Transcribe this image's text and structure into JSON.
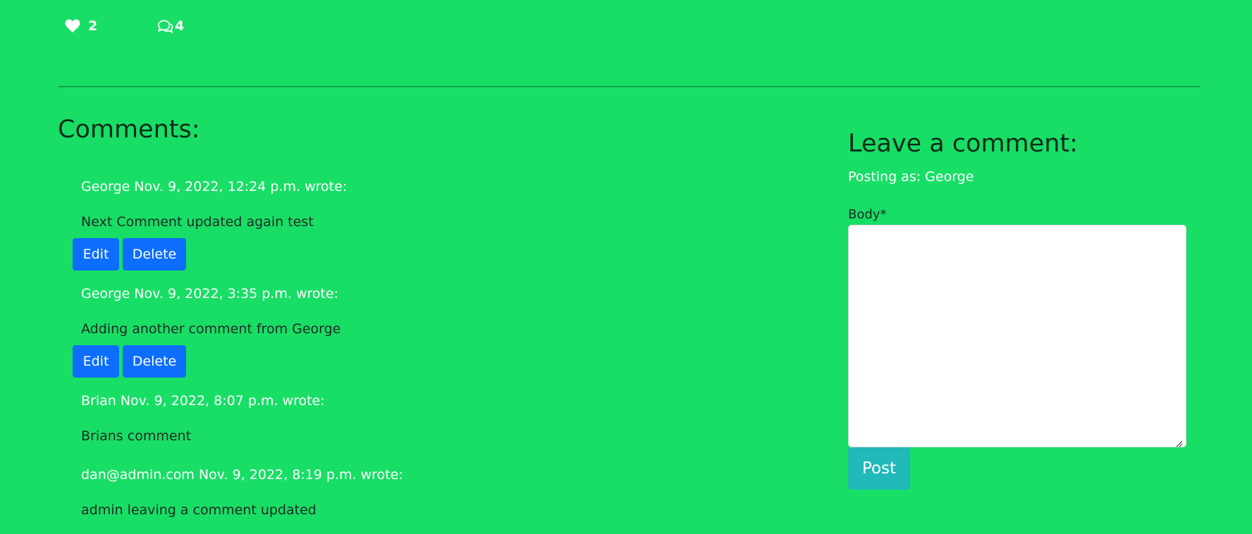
{
  "post_stats": {
    "likes": "2",
    "comments": "4",
    "like_icon": "heart-icon",
    "comment_icon": "chat-bubbles-icon"
  },
  "comments_section": {
    "title": "Comments:",
    "items": [
      {
        "meta": "George Nov. 9, 2022, 12:24 p.m. wrote:",
        "body": "Next Comment updated again test",
        "edit_label": "Edit",
        "delete_label": "Delete"
      },
      {
        "meta": "George Nov. 9, 2022, 3:35 p.m. wrote:",
        "body": "Adding another comment from George",
        "edit_label": "Edit",
        "delete_label": "Delete"
      },
      {
        "meta": "Brian Nov. 9, 2022, 8:07 p.m. wrote:",
        "body": "Brians comment"
      },
      {
        "meta": "dan@admin.com Nov. 9, 2022, 8:19 p.m. wrote:",
        "body": "admin leaving a comment updated"
      }
    ]
  },
  "comment_form": {
    "title": "Leave a comment:",
    "posting_as": "Posting as: George",
    "body_label": "Body*",
    "body_value": "",
    "post_label": "Post"
  },
  "colors": {
    "background": "#18de66",
    "action_button": "#0d6efd",
    "post_button": "#21b9b9"
  }
}
